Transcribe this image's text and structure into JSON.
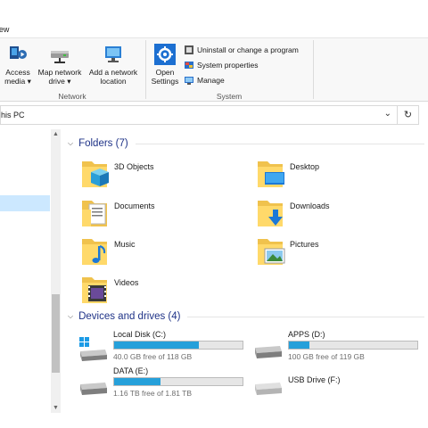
{
  "ribbon": {
    "tab_label": "View",
    "network": {
      "group_label": "Network",
      "access_media": "Access media ▾",
      "map_network_drive": "Map network drive ▾",
      "add_network_location": "Add a network location"
    },
    "system": {
      "group_label": "System",
      "open_settings": "Open Settings",
      "uninstall": "Uninstall or change a program",
      "system_properties": "System properties",
      "manage": "Manage"
    }
  },
  "addressbar": {
    "path": "his PC"
  },
  "sections": {
    "folders_header": "Folders (7)",
    "devices_header": "Devices and drives (4)"
  },
  "folders": [
    {
      "name": "3D Objects",
      "icon": "3d-objects-folder-icon"
    },
    {
      "name": "Desktop",
      "icon": "desktop-folder-icon"
    },
    {
      "name": "Documents",
      "icon": "documents-folder-icon"
    },
    {
      "name": "Downloads",
      "icon": "downloads-folder-icon"
    },
    {
      "name": "Music",
      "icon": "music-folder-icon"
    },
    {
      "name": "Pictures",
      "icon": "pictures-folder-icon"
    },
    {
      "name": "Videos",
      "icon": "videos-folder-icon"
    }
  ],
  "drives": [
    {
      "name": "Local Disk (C:)",
      "free": "40.0 GB free of 118 GB",
      "used_fraction": 0.661,
      "icon": "windows-drive-icon"
    },
    {
      "name": "APPS (D:)",
      "free": "100 GB free of 119 GB",
      "used_fraction": 0.16,
      "icon": "hard-drive-icon"
    },
    {
      "name": "DATA (E:)",
      "free": "1.16 TB free of 1.81 TB",
      "used_fraction": 0.359,
      "icon": "hard-drive-icon"
    },
    {
      "name": "USB Drive (F:)",
      "free": "",
      "used_fraction": null,
      "icon": "usb-drive-icon"
    }
  ],
  "colors": {
    "accent": "#26a0da",
    "header_text": "#1e3287",
    "selection": "#cce8ff"
  }
}
